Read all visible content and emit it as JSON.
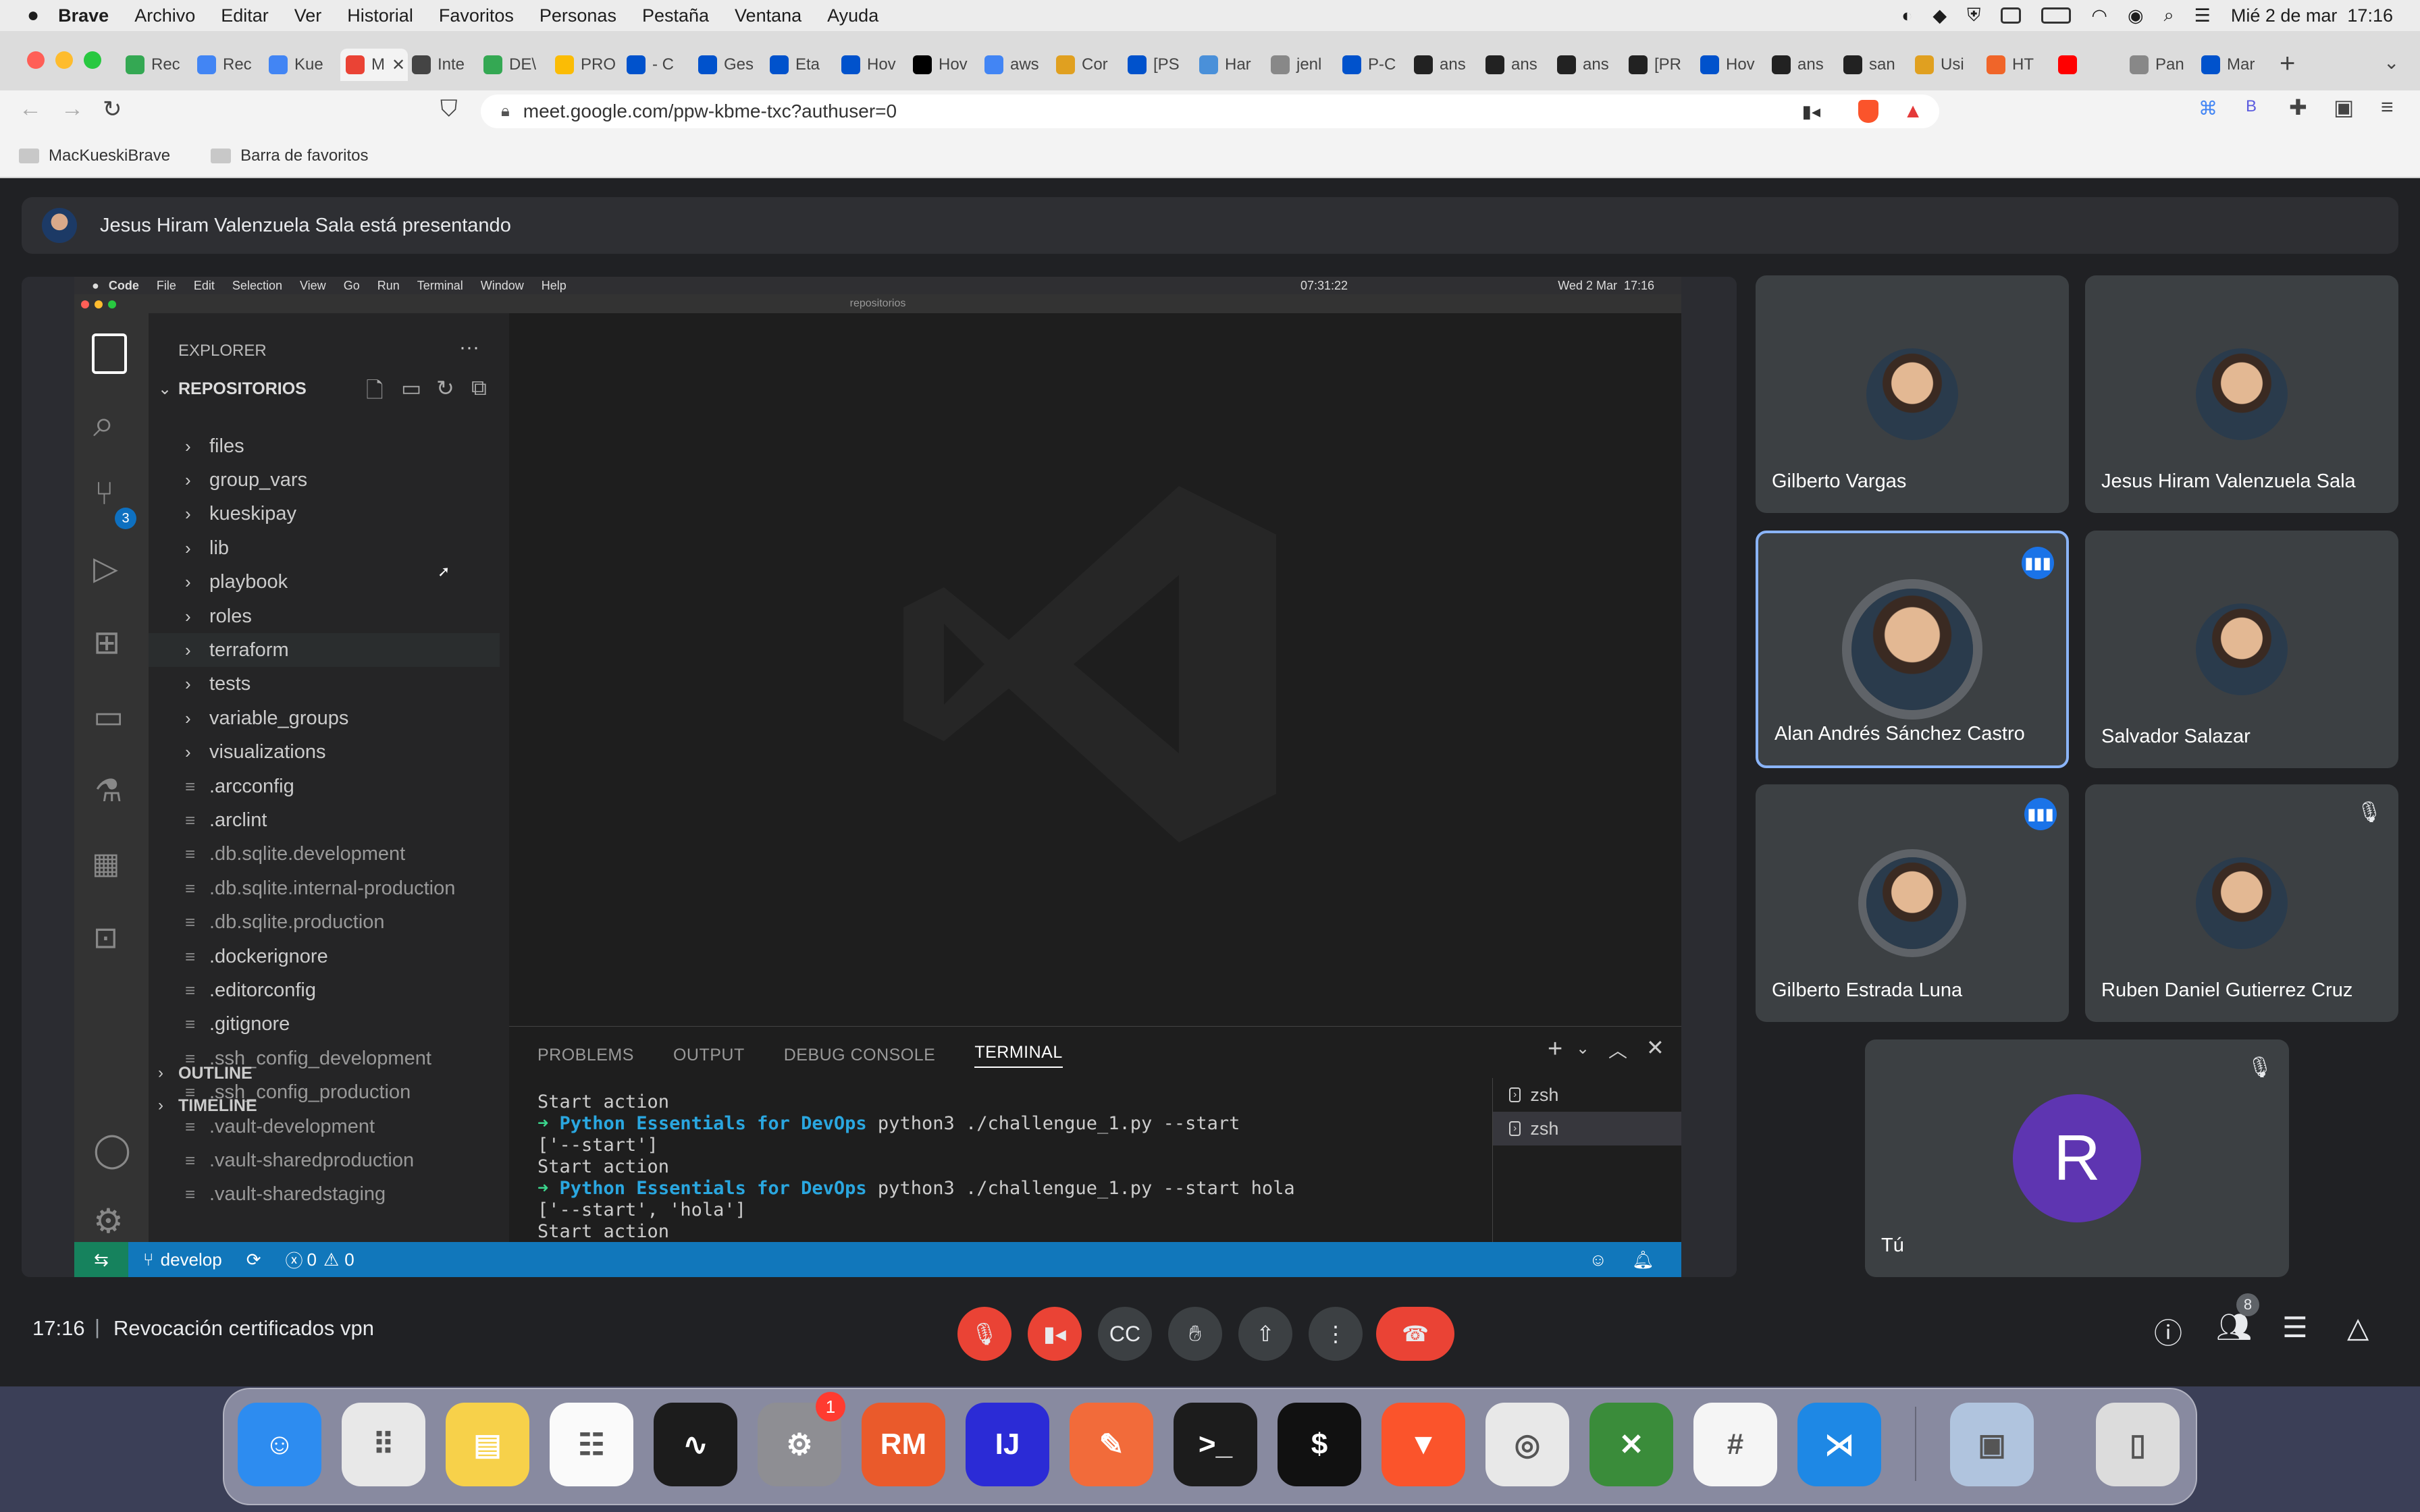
{
  "menubar": {
    "app": "Brave",
    "items": [
      "Archivo",
      "Editar",
      "Ver",
      "Historial",
      "Favoritos",
      "Personas",
      "Pestaña",
      "Ventana",
      "Ayuda"
    ],
    "clock": "Mié 2 de mar  17:16"
  },
  "tabs": [
    "Rec",
    "Rec",
    "Kue",
    "M",
    "Inte",
    "DE\\",
    "PRO",
    "- C",
    "Ges",
    "Eta",
    "Hov",
    "Hov",
    "aws",
    "Cor",
    "[PS",
    "Har",
    "jenl",
    "P-C",
    "ans",
    "ans",
    "ans",
    "[PR",
    "Hov",
    "ans",
    "san",
    "Usi",
    "HT",
    "",
    "Pan",
    "Mar"
  ],
  "browser": {
    "url": "meet.google.com/ppw-kbme-txc?authuser=0",
    "bookmarks": [
      "MacKueskiBrave",
      "Barra de favoritos"
    ]
  },
  "meet": {
    "presenter_banner": "Jesus Hiram Valenzuela Sala está presentando",
    "time": "17:16",
    "separator": "|",
    "meeting_title": "Revocación certificados vpn",
    "participants_count": "8",
    "participants": [
      {
        "name": "Gilberto Vargas"
      },
      {
        "name": "Jesus Hiram Valenzuela Sala"
      },
      {
        "name": "Alan Andrés Sánchez Castro"
      },
      {
        "name": "Salvador Salazar"
      },
      {
        "name": "Gilberto Estrada Luna"
      },
      {
        "name": "Ruben Daniel Gutierrez Cruz"
      },
      {
        "name": "Tú",
        "initial": "R"
      }
    ]
  },
  "vscode": {
    "menubar": [
      "Code",
      "File",
      "Edit",
      "Selection",
      "View",
      "Go",
      "Run",
      "Terminal",
      "Window",
      "Help"
    ],
    "menubar_right": "Wed 2 Mar  17:16",
    "timer": "07:31:22",
    "window_title": "repositorios",
    "explorer_title": "EXPLORER",
    "explorer_more": "···",
    "section": "REPOSITORIOS",
    "scm_badge": "3",
    "folders": [
      "files",
      "group_vars",
      "kueskipay",
      "lib",
      "playbook",
      "roles",
      "terraform",
      "tests",
      "variable_groups",
      "visualizations"
    ],
    "files": [
      ".arcconfig",
      ".arclint",
      ".db.sqlite.development",
      ".db.sqlite.internal-production",
      ".db.sqlite.production",
      ".dockerignore",
      ".editorconfig",
      ".gitignore",
      ".ssh_config_development",
      ".ssh_config_production",
      ".vault-development",
      ".vault-sharedproduction",
      ".vault-sharedstaging"
    ],
    "outline": "OUTLINE",
    "timeline": "TIMELINE",
    "panel_tabs": [
      "PROBLEMS",
      "OUTPUT",
      "DEBUG CONSOLE",
      "TERMINAL"
    ],
    "terminal_lines": [
      {
        "text": "Start action"
      },
      {
        "prompt": "➜ ",
        "dir": "Python Essentials for DevOps",
        "cmd": " python3 ./challengue_1.py --start"
      },
      {
        "text": "['--start']"
      },
      {
        "text": "Start action"
      },
      {
        "prompt": "➜ ",
        "dir": "Python Essentials for DevOps",
        "cmd": " python3 ./challengue_1.py --start hola"
      },
      {
        "text": "['--start', 'hola']"
      },
      {
        "text": "Start action"
      }
    ],
    "terminals": [
      "zsh",
      "zsh"
    ],
    "status": {
      "branch": "develop",
      "errors": "0",
      "warnings": "0"
    }
  },
  "dock": {
    "apps": [
      "Finder",
      "Launchpad",
      "Notes",
      "Reminders",
      "Activity Monitor",
      "System Preferences",
      "RubyMine",
      "IntelliJ IDEA",
      "Postman",
      "Terminal",
      "iTerm",
      "Brave",
      "Chrome",
      "XQuartz",
      "Slack",
      "VS Code",
      "Preview",
      "Trash"
    ],
    "sysprefs_badge": "1"
  }
}
